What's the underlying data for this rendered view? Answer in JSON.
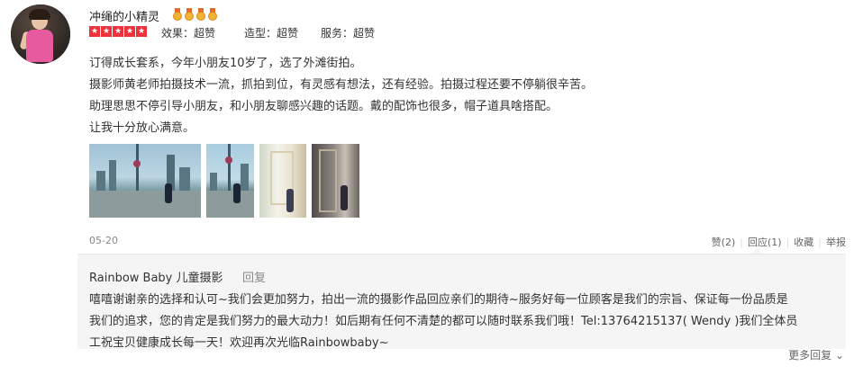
{
  "reviewer": {
    "name": "冲绳的小精灵",
    "medal_count": 4,
    "star_rating": 5
  },
  "scores": [
    {
      "label": "效果：超赞"
    },
    {
      "label": "造型：超赞"
    },
    {
      "label": "服务：超赞"
    }
  ],
  "review": {
    "lines": [
      "订得成长套系，今年小朋友10岁了，选了外滩街拍。",
      "摄影师黄老师拍摄技术一流，抓拍到位，有灵感有想法，还有经验。拍摄过程还要不停躺很辛苦。",
      "助理思思不停引导小朋友，和小朋友聊感兴趣的话题。戴的配饰也很多，帽子道具啥搭配。",
      "让我十分放心满意。"
    ]
  },
  "photos": [
    "photo-bund-skyline-wide",
    "photo-bund-tower-portrait",
    "photo-indoor-window",
    "photo-indoor-hallway"
  ],
  "meta": {
    "date": "05-20",
    "like_label": "赞(2)",
    "reply_label": "回应(1)",
    "collect_label": "收藏",
    "report_label": "举报"
  },
  "shop_reply": {
    "shop_name": "Rainbow Baby 儿童摄影",
    "reply_link": "回复",
    "lines": [
      "嘻嘻谢谢亲的选择和认可~我们会更加努力，拍出一流的摄影作品回应亲们的期待~服务好每一位顾客是我们的宗旨、保证每一份品质是",
      "我们的追求，您的肯定是我们努力的最大动力！如后期有任何不清楚的都可以随时联系我们哦！Tel:13764215137( Wendy )我们全体员",
      "工祝宝贝健康成长每一天！欢迎再次光临Rainbowbaby~"
    ]
  },
  "more_replies": "更多回复 ⌄",
  "colors": {
    "star_red": "#f0323c",
    "reply_bg": "#f5f5f5",
    "medal_gold": "#f3b233"
  }
}
